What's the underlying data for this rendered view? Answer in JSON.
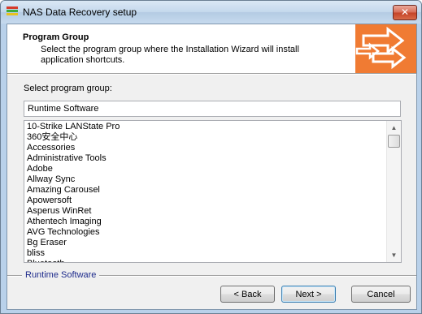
{
  "window": {
    "title": "NAS Data Recovery setup",
    "close_label": "✕"
  },
  "header": {
    "title": "Program Group",
    "description": "Select the program group where the Installation Wizard will install application shortcuts."
  },
  "form": {
    "select_label": "Select program group:",
    "group_value": "Runtime Software"
  },
  "program_groups": [
    "10-Strike LANState Pro",
    "360安全中心",
    "Accessories",
    "Administrative Tools",
    "Adobe",
    "Allway Sync",
    "Amazing Carousel",
    "Apowersoft",
    "Asperus WinRet",
    "Athentech Imaging",
    "AVG Technologies",
    "Bg Eraser",
    "bliss",
    "Bluetooth"
  ],
  "footer": {
    "brand": "Runtime Software",
    "back_label": "< Back",
    "next_label": "Next >",
    "cancel_label": "Cancel"
  },
  "icons": {
    "app": "setup-app-icon",
    "header_art": "arrows-icon",
    "scroll_up": "chevron-up-icon",
    "scroll_down": "chevron-down-icon"
  },
  "colors": {
    "header_art": "#f07b33",
    "brand_text": "#1e2b8c"
  }
}
